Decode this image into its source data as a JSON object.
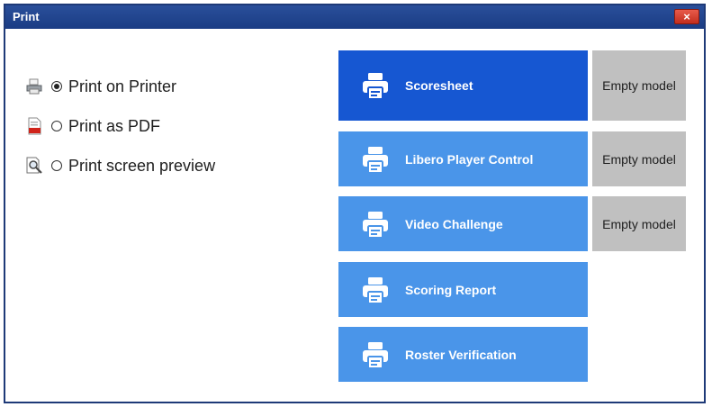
{
  "window": {
    "title": "Print",
    "close_label": "×"
  },
  "options": [
    {
      "label": "Print on Printer",
      "selected": true,
      "icon": "printer-icon"
    },
    {
      "label": "Print as PDF",
      "selected": false,
      "icon": "pdf-file-icon"
    },
    {
      "label": "Print screen preview",
      "selected": false,
      "icon": "preview-magnifier-icon"
    }
  ],
  "reports": [
    {
      "label": "Scoresheet",
      "active": true,
      "model": "Empty model",
      "icon": "printer-icon"
    },
    {
      "label": "Libero Player Control",
      "active": false,
      "model": "Empty model",
      "icon": "printer-icon"
    },
    {
      "label": "Video Challenge",
      "active": false,
      "model": "Empty model",
      "icon": "printer-icon"
    },
    {
      "label": "Scoring Report",
      "active": false,
      "model": "",
      "icon": "printer-icon"
    },
    {
      "label": "Roster Verification",
      "active": false,
      "model": "",
      "icon": "printer-icon"
    }
  ],
  "colors": {
    "titlebar": "#1a3c84",
    "report_active": "#1657d2",
    "report_default": "#4a95e9",
    "model_box": "#c0c0c0",
    "close_button": "#d63a2a"
  }
}
